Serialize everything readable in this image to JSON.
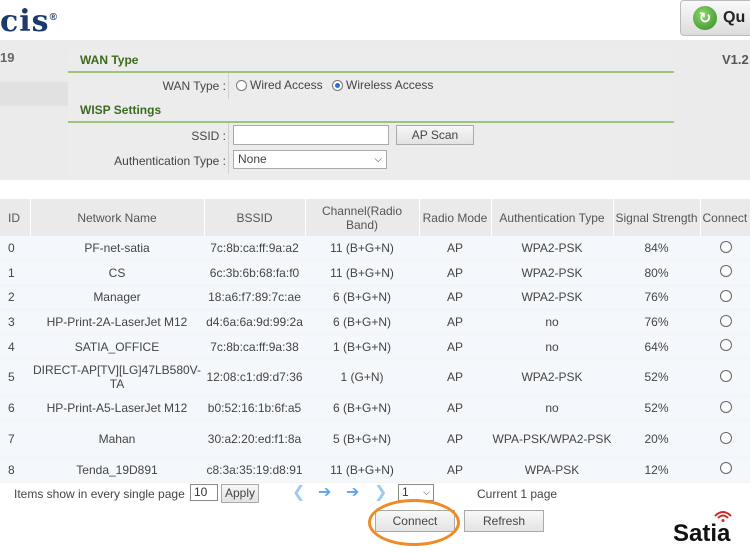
{
  "header": {
    "logo_text": "cis",
    "logo_mark": "®",
    "quick_label": "Qu",
    "left_tab": "19",
    "version": "V1.2"
  },
  "wan": {
    "section_title": "WAN Type",
    "type_label": "WAN Type :",
    "options": [
      {
        "label": "Wired Access",
        "selected": false
      },
      {
        "label": "Wireless Access",
        "selected": true
      }
    ]
  },
  "wisp": {
    "section_title": "WISP Settings",
    "ssid_label": "SSID :",
    "ssid_value": "",
    "scan_label": "AP Scan",
    "auth_label": "Authentication Type :",
    "auth_value": "None"
  },
  "table": {
    "headers": [
      "ID",
      "Network Name",
      "BSSID",
      "Channel(Radio Band)",
      "Radio Mode",
      "Authentication Type",
      "Signal Strength",
      "Connect"
    ],
    "rows": [
      [
        "0",
        "PF-net-satia",
        "7c:8b:ca:ff:9a:a2",
        "11 (B+G+N)",
        "AP",
        "WPA2-PSK",
        "84%"
      ],
      [
        "1",
        "CS",
        "6c:3b:6b:68:fa:f0",
        "11 (B+G+N)",
        "AP",
        "WPA2-PSK",
        "80%"
      ],
      [
        "2",
        "Manager",
        "18:a6:f7:89:7c:ae",
        "6 (B+G+N)",
        "AP",
        "WPA2-PSK",
        "76%"
      ],
      [
        "3",
        "HP-Print-2A-LaserJet M12",
        "d4:6a:6a:9d:99:2a",
        "6 (B+G+N)",
        "AP",
        "no",
        "76%"
      ],
      [
        "4",
        "SATIA_OFFICE",
        "7c:8b:ca:ff:9a:38",
        "1 (B+G+N)",
        "AP",
        "no",
        "64%"
      ],
      [
        "5",
        "DIRECT-AP[TV][LG]47LB580V-TA",
        "12:08:c1:d9:d7:36",
        "1 (G+N)",
        "AP",
        "WPA2-PSK",
        "52%"
      ],
      [
        "6",
        "HP-Print-A5-LaserJet M12",
        "b0:52:16:1b:6f:a5",
        "6 (B+G+N)",
        "AP",
        "no",
        "52%"
      ],
      [
        "7",
        "Mahan",
        "30:a2:20:ed:f1:8a",
        "5 (B+G+N)",
        "AP",
        "WPA-PSK/WPA2-PSK",
        "20%"
      ],
      [
        "8",
        "Tenda_19D891",
        "c8:3a:35:19:d8:91",
        "11 (B+G+N)",
        "AP",
        "WPA-PSK",
        "12%"
      ]
    ]
  },
  "pager": {
    "items_label": "Items show in every single page",
    "page_size": "10",
    "apply_label": "Apply",
    "page_value": "1",
    "current_label": "Current 1 page"
  },
  "actions": {
    "connect_label": "Connect",
    "refresh_label": "Refresh"
  },
  "watermark": "Satia",
  "colors": {
    "accent_green": "#3a6b1f",
    "section_rule": "#9cc57a",
    "highlight_circle": "#f08a24",
    "nav_blue": "#5aa6f0"
  }
}
